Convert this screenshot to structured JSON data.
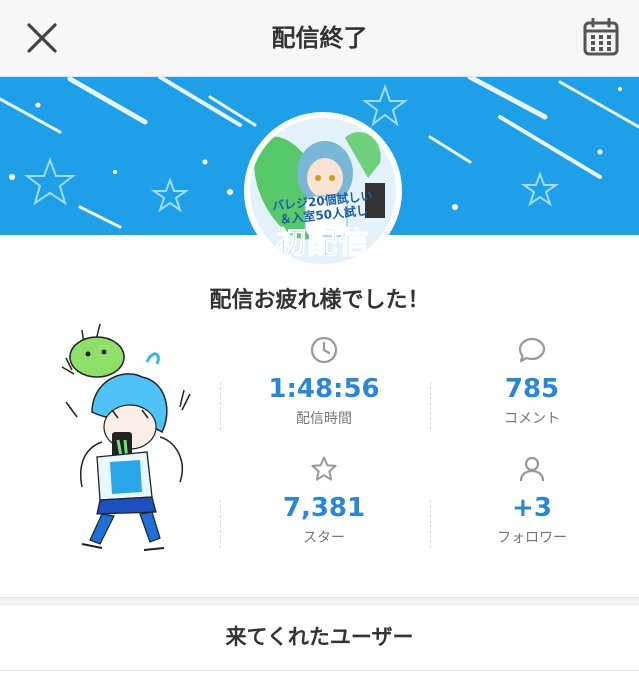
{
  "header": {
    "title": "配信終了"
  },
  "banner": {
    "avatar_caption": "バレジ20個試しい\n＆入室50人試し",
    "avatar_title": "初配信",
    "accent_color": "#1e9fe8"
  },
  "main": {
    "thanks_message": "配信お疲れ様でした！"
  },
  "stats": [
    {
      "icon": "clock-icon",
      "value": "1:48:56",
      "label": "配信時間"
    },
    {
      "icon": "comment-icon",
      "value": "785",
      "label": "コメント"
    },
    {
      "icon": "star-icon",
      "value": "7,381",
      "label": "スター"
    },
    {
      "icon": "user-icon",
      "value": "+3",
      "label": "フォロワー"
    }
  ],
  "footer": {
    "visitors_label": "来てくれたユーザー"
  }
}
